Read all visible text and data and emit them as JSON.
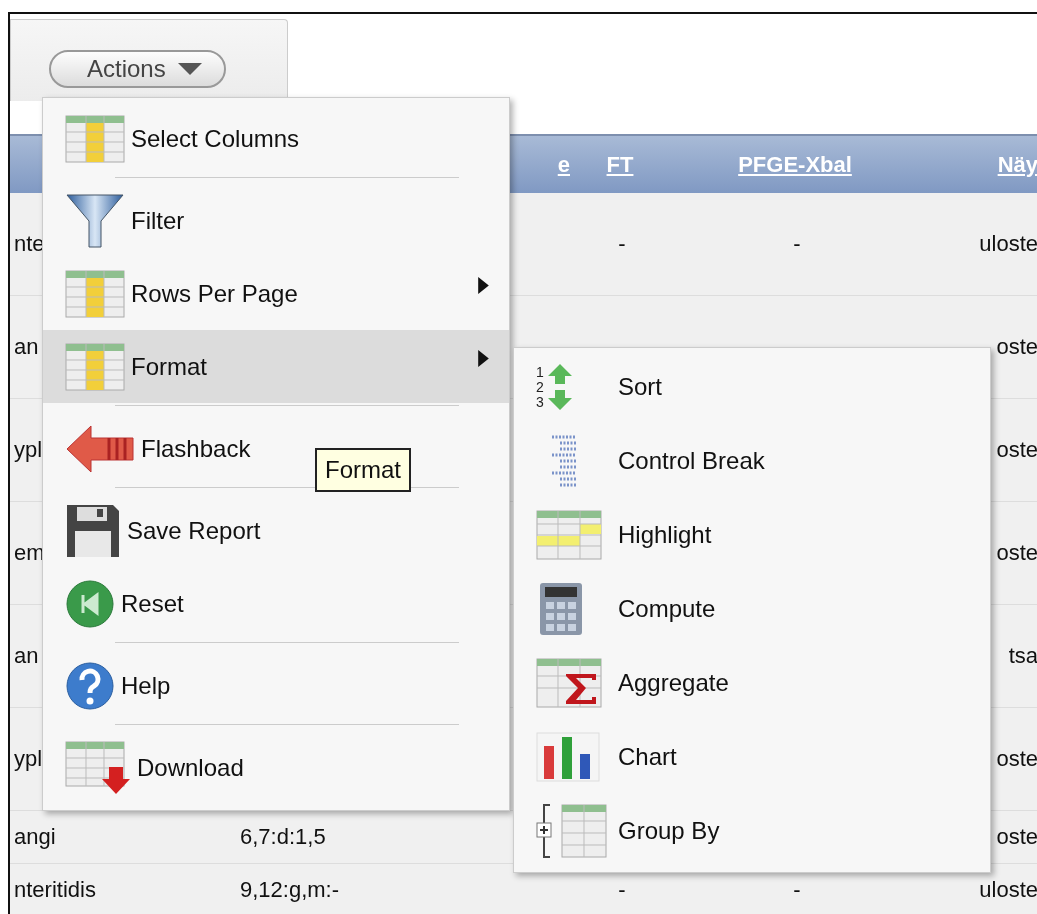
{
  "actions_button": {
    "label": "Actions"
  },
  "table": {
    "columns": [
      null,
      "e",
      "FT",
      "PFGE-Xbal",
      "Näy"
    ],
    "rows": [
      [
        "nte",
        null,
        "-",
        "-",
        "uloste"
      ],
      [
        "an",
        null,
        null,
        null,
        "oste"
      ],
      [
        "ypl",
        null,
        null,
        null,
        "oste"
      ],
      [
        "em",
        null,
        null,
        null,
        "oste"
      ],
      [
        "an",
        null,
        null,
        null,
        "tsa"
      ],
      [
        "ypl",
        null,
        null,
        null,
        "oste"
      ],
      [
        "angi",
        "6,7:d:1,5",
        null,
        null,
        "oste"
      ],
      [
        "nteritidis",
        "9,12:g,m:-",
        "-",
        "-",
        "uloste"
      ]
    ]
  },
  "actions_menu": {
    "items": [
      {
        "kind": "item",
        "label": "Select Columns",
        "has_submenu": false,
        "selected": false
      },
      {
        "kind": "separator"
      },
      {
        "kind": "item",
        "label": "Filter",
        "has_submenu": false,
        "selected": false
      },
      {
        "kind": "item",
        "label": "Rows Per Page",
        "has_submenu": true,
        "selected": false
      },
      {
        "kind": "item",
        "label": "Format",
        "has_submenu": true,
        "selected": true
      },
      {
        "kind": "separator"
      },
      {
        "kind": "item",
        "label": "Flashback",
        "has_submenu": false,
        "selected": false
      },
      {
        "kind": "separator"
      },
      {
        "kind": "item",
        "label": "Save Report",
        "has_submenu": false,
        "selected": false
      },
      {
        "kind": "item",
        "label": "Reset",
        "has_submenu": false,
        "selected": false
      },
      {
        "kind": "separator"
      },
      {
        "kind": "item",
        "label": "Help",
        "has_submenu": false,
        "selected": false
      },
      {
        "kind": "separator"
      },
      {
        "kind": "item",
        "label": "Download",
        "has_submenu": false,
        "selected": false
      }
    ]
  },
  "tooltip": "Format",
  "format_submenu": {
    "items": [
      {
        "label": "Sort",
        "digits": [
          "1",
          "2",
          "3"
        ]
      },
      {
        "label": "Control Break"
      },
      {
        "label": "Highlight"
      },
      {
        "label": "Compute"
      },
      {
        "label": "Aggregate"
      },
      {
        "label": "Chart"
      },
      {
        "label": "Group By"
      }
    ]
  }
}
